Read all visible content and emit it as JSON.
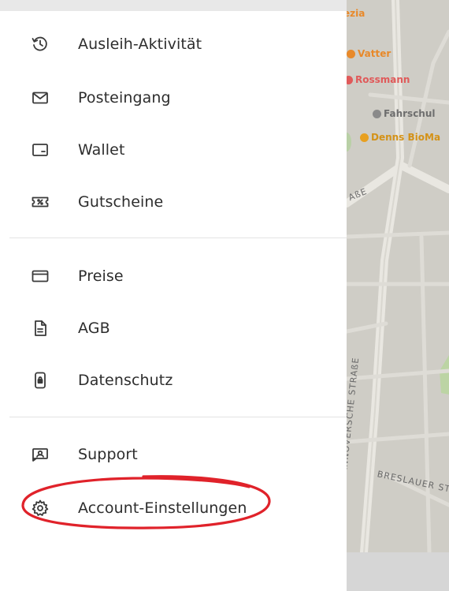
{
  "menu": {
    "section1": [
      {
        "label": "Ausleih-Aktivität",
        "icon": "history-icon"
      },
      {
        "label": "Posteingang",
        "icon": "mail-icon"
      },
      {
        "label": "Wallet",
        "icon": "wallet-icon"
      },
      {
        "label": "Gutscheine",
        "icon": "voucher-icon"
      }
    ],
    "section2": [
      {
        "label": "Preise",
        "icon": "credit-card-icon"
      },
      {
        "label": "AGB",
        "icon": "document-icon"
      },
      {
        "label": "Datenschutz",
        "icon": "lock-phone-icon"
      }
    ],
    "section3": [
      {
        "label": "Support",
        "icon": "support-icon"
      },
      {
        "label": "Account-Einstellungen",
        "icon": "gear-icon"
      }
    ]
  },
  "annotation": {
    "color": "#e0222a"
  },
  "map": {
    "pois": [
      {
        "label": "ezia",
        "color": "#e8892a"
      },
      {
        "label": "Vatter",
        "color": "#e8892a"
      },
      {
        "label": "Rossmann",
        "color": "#e05a5a"
      },
      {
        "label": "Fahrschul",
        "color": "#8a8a8a"
      },
      {
        "label": "Denns BioMa",
        "color": "#e8a020"
      }
    ],
    "streets": [
      {
        "label": "ANNOVERSCHE STRAßE"
      },
      {
        "label": "BRESLAUER ST"
      },
      {
        "label": "AßE"
      }
    ]
  },
  "colors": {
    "text": "#2d2d2d",
    "icon": "#3a3a3a",
    "divider": "#e3e3e3",
    "map_bg": "#cfcdc6"
  }
}
